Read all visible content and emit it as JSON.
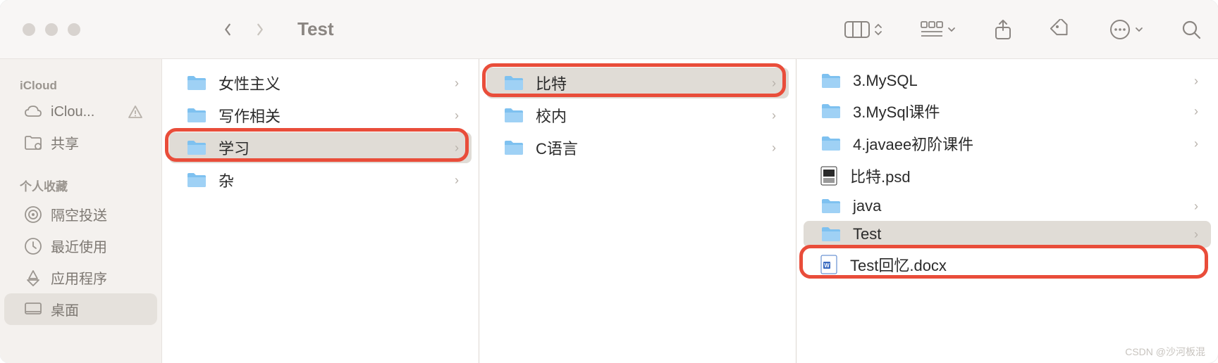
{
  "window": {
    "title": "Test"
  },
  "sidebar": {
    "sections": [
      {
        "header": "iCloud",
        "items": [
          {
            "label": "iClou...",
            "icon": "cloud",
            "warn": true
          },
          {
            "label": "共享",
            "icon": "shared-folder"
          }
        ]
      },
      {
        "header": "个人收藏",
        "items": [
          {
            "label": "隔空投送",
            "icon": "airdrop"
          },
          {
            "label": "最近使用",
            "icon": "clock"
          },
          {
            "label": "应用程序",
            "icon": "apps"
          },
          {
            "label": "桌面",
            "icon": "desktop",
            "sel": true
          }
        ]
      }
    ]
  },
  "columns": [
    {
      "items": [
        {
          "label": "女性主义",
          "type": "folder"
        },
        {
          "label": "写作相关",
          "type": "folder"
        },
        {
          "label": "学习",
          "type": "folder",
          "sel": true,
          "hl": true
        },
        {
          "label": "杂",
          "type": "folder"
        }
      ]
    },
    {
      "items": [
        {
          "label": "比特",
          "type": "folder",
          "sel": true,
          "hl": true
        },
        {
          "label": "校内",
          "type": "folder"
        },
        {
          "label": "C语言",
          "type": "folder"
        }
      ]
    },
    {
      "items": [
        {
          "label": "3.MySQL",
          "type": "folder",
          "chev": true
        },
        {
          "label": "3.MySql课件",
          "type": "folder",
          "chev": true
        },
        {
          "label": "4.javaee初阶课件",
          "type": "folder",
          "chev": true
        },
        {
          "label": "比特.psd",
          "type": "psd"
        },
        {
          "label": "java",
          "type": "folder",
          "chev": true
        },
        {
          "label": "Test",
          "type": "folder",
          "sel": true,
          "chev": true
        },
        {
          "label": "Test回忆.docx",
          "type": "docx",
          "hl": true
        }
      ]
    }
  ],
  "watermark": "CSDN @沙河板混"
}
